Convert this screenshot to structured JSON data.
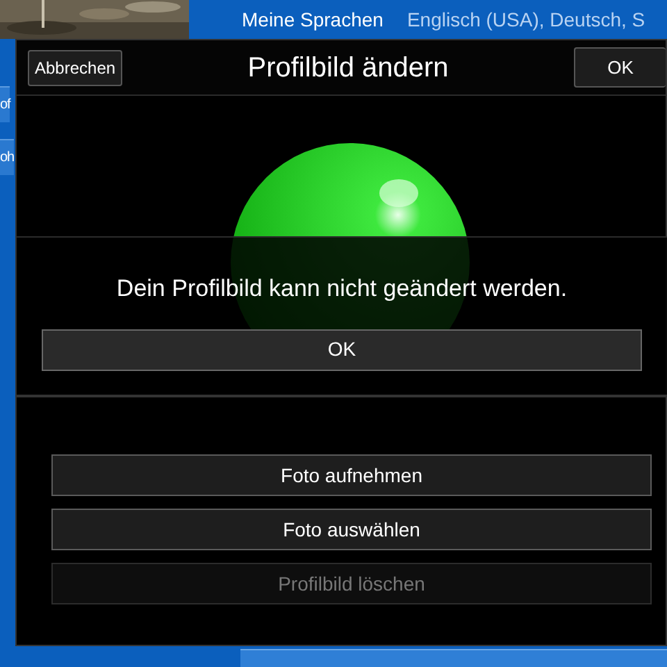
{
  "background": {
    "languages_label": "Meine Sprachen",
    "languages_value": "Englisch (USA), Deutsch, S",
    "side_items": [
      "of",
      "oh"
    ]
  },
  "dialog": {
    "title": "Profilbild ändern",
    "cancel": "Abbrechen",
    "confirm": "OK",
    "actions": [
      {
        "label": "Foto aufnehmen",
        "disabled": false
      },
      {
        "label": "Foto auswählen",
        "disabled": false
      },
      {
        "label": "Profilbild löschen",
        "disabled": true
      }
    ]
  },
  "alert": {
    "message": "Dein Profilbild kann nicht geändert werden.",
    "button": "OK"
  }
}
